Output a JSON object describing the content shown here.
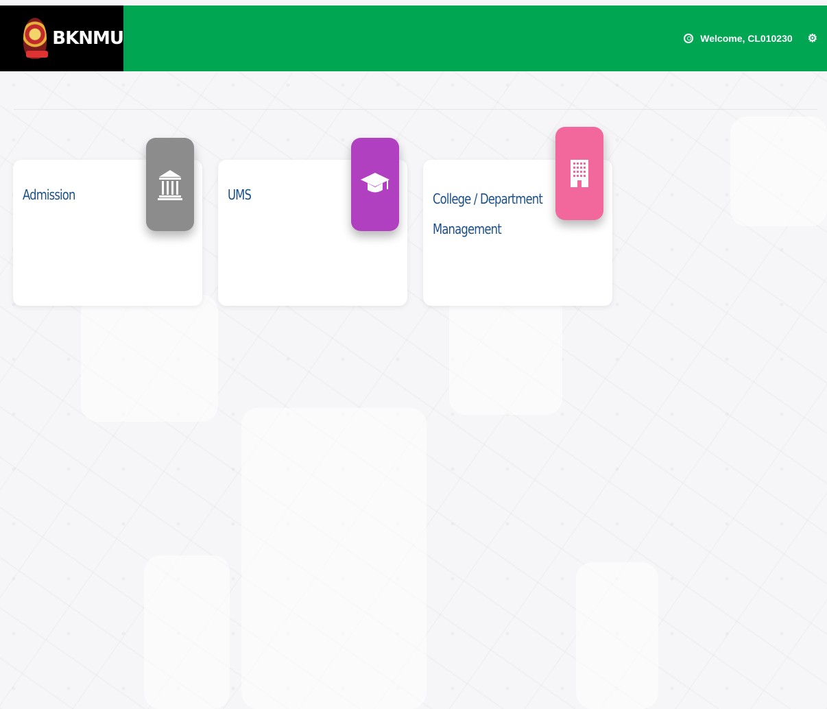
{
  "header": {
    "brand": "BKNMU",
    "welcome": "Welcome, CL010230",
    "user_icon": "user-circle-icon",
    "settings_icon": "cogs-icon"
  },
  "tiles": [
    {
      "label": "Admission",
      "icon": "institution-icon",
      "color": "#8c8c8c"
    },
    {
      "label": "UMS",
      "icon": "graduation-cap-icon",
      "color": "#b040c0"
    },
    {
      "label": "College / Department Management",
      "icon": "building-icon",
      "color": "#f2679c"
    }
  ],
  "colors": {
    "header": "#00a651",
    "brand_bg": "#000000",
    "tile_text": "#1b4f8a"
  }
}
